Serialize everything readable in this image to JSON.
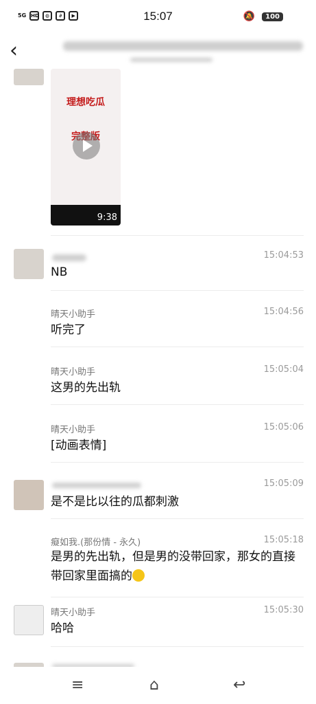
{
  "status_bar": {
    "network": "5G",
    "time": "15:07",
    "battery": "100"
  },
  "messages": [
    {
      "name": "",
      "time": "15:04:53",
      "text": "NB"
    },
    {
      "name": "晴天小助手",
      "time": "15:04:56",
      "text": "听完了"
    },
    {
      "name": "晴天小助手",
      "time": "15:05:04",
      "text": "这男的先出轨"
    },
    {
      "name": "晴天小助手",
      "time": "15:05:06",
      "text": "[动画表情]"
    },
    {
      "name": "",
      "time": "15:05:09",
      "text": "是不是比以往的瓜都刺激"
    },
    {
      "name": "癡如我.(那份情 - 永久)",
      "time": "15:05:18",
      "text": "是男的先出轨，但是男的没带回家，那女的直接带回家里面搞的"
    },
    {
      "name": "晴天小助手",
      "time": "15:05:30",
      "text": "哈哈"
    }
  ],
  "video": {
    "title1": "理想吃瓜",
    "title2": "完整版",
    "duration": "9:38"
  },
  "nav": {
    "menu": "≡",
    "home": "⌂",
    "back": "↩"
  }
}
